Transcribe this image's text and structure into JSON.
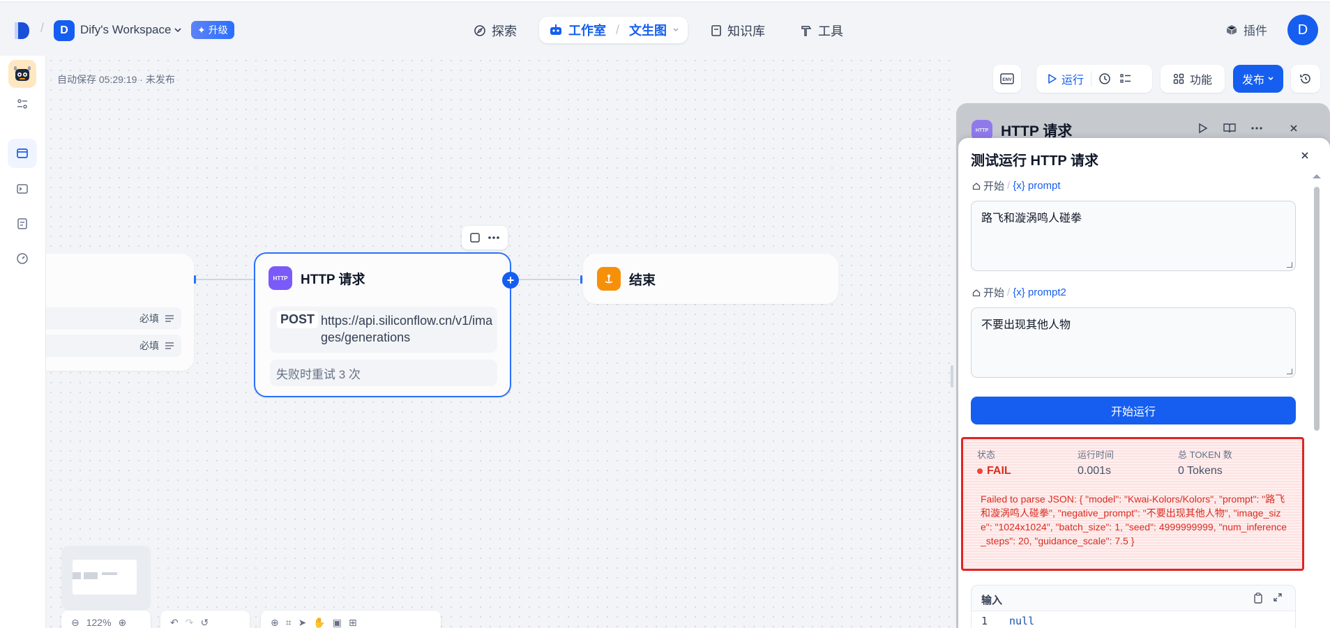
{
  "topnav": {
    "workspace_initial": "D",
    "workspace_name": "Dify's Workspace",
    "upgrade_label": "升级",
    "explore_label": "探索",
    "studio_label": "工作室",
    "current_app": "文生图",
    "knowledge_label": "知识库",
    "tools_label": "工具",
    "plugins_label": "插件",
    "avatar_initial": "D"
  },
  "canvas": {
    "autosave_text": "自动保存 05:29:19 · 未发布",
    "start_node": {
      "rows": [
        "必填",
        "必填"
      ]
    },
    "http_node": {
      "badge": "HTTP",
      "title": "HTTP 请求",
      "method": "POST",
      "url": "https://api.siliconflow.cn/v1/images/generations",
      "retry_text": "失败时重试 3 次"
    },
    "end_node": {
      "title": "结束"
    },
    "zoom_label": "122%"
  },
  "toolbar": {
    "env_label": "ENV",
    "run_label": "运行",
    "features_label": "功能",
    "publish_label": "发布"
  },
  "panel": {
    "back_title": "HTTP 请求",
    "back_badge": "HTTP",
    "title": "测试运行 HTTP 请求",
    "var1": {
      "source": "开始",
      "sep": "/",
      "name": "{x} prompt",
      "value": "路飞和漩涡鸣人碰拳"
    },
    "var2": {
      "source": "开始",
      "sep": "/",
      "name": "{x} prompt2",
      "value": "不要出现其他人物"
    },
    "run_button": "开始运行",
    "result": {
      "status_label": "状态",
      "status_value": "FAIL",
      "time_label": "运行时间",
      "time_value": "0.001s",
      "token_label": "总 TOKEN 数",
      "token_value": "0 Tokens",
      "error": "Failed to parse JSON: {   \"model\": \"Kwai-Kolors/Kolors\",   \"prompt\": \"路飞和漩涡鸣人碰拳\",   \"negative_prompt\": \"不要出现其他人物\",   \"image_size\": \"1024x1024\",   \"batch_size\": 1,   \"seed\": 4999999999,   \"num_inference_steps\": 20,   \"guidance_scale\": 7.5 }"
    },
    "input_section": {
      "label": "输入",
      "line_number": "1",
      "code": "null"
    }
  },
  "colors": {
    "accent": "#155eef",
    "http_badge": "#7a5af8",
    "end_badge": "#f79009",
    "fail": "#d92d20"
  }
}
